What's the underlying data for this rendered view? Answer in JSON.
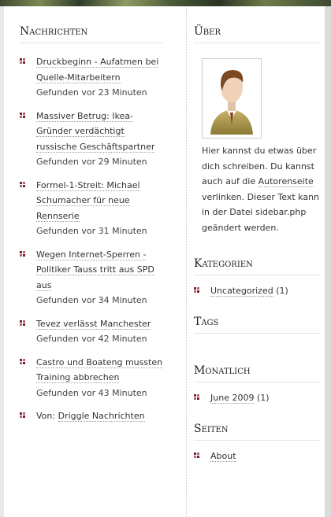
{
  "left": {
    "title": "Nachrichten",
    "items": [
      {
        "title": "Druckbeginn - Aufatmen bei Quelle-Mitarbeitern",
        "meta": "Gefunden vor 23 Minuten"
      },
      {
        "title": "Massiver Betrug: Ikea-Gründer verdächtigt russische Geschäftspartner",
        "meta": "Gefunden vor 29 Minuten"
      },
      {
        "title": "Formel-1-Streit: Michael Schumacher für neue Rennserie",
        "meta": "Gefunden vor 31 Minuten"
      },
      {
        "title": "Wegen Internet-Sperren - Politiker Tauss tritt aus SPD aus",
        "meta": "Gefunden vor 34 Minuten"
      },
      {
        "title": "Tevez verlässt Manchester",
        "meta": "Gefunden vor 42 Minuten"
      },
      {
        "title": "Castro und Boateng mussten Training abbrechen",
        "meta": "Gefunden vor 43 Minuten"
      }
    ],
    "source_prefix": "Von:",
    "source_link": "Driggle Nachrichten"
  },
  "right": {
    "about_title": "Über",
    "about_text_1": "Hier kannst du etwas über dich schreiben. Du kannst auch auf die",
    "about_link": "Autorenseite",
    "about_text_2": "verlinken. Dieser Text kann in der Datei sidebar.php geändert werden.",
    "categories_title": "Kategorien",
    "category_link": "Uncategorized",
    "category_count": "(1)",
    "tags_title": "Tags",
    "monthly_title": "Monatlich",
    "month_link": "June 2009",
    "month_count": "(1)",
    "pages_title": "Seiten",
    "page_link": "About"
  },
  "colors": {
    "bullet": "#7a1f2b",
    "text": "#333333"
  }
}
